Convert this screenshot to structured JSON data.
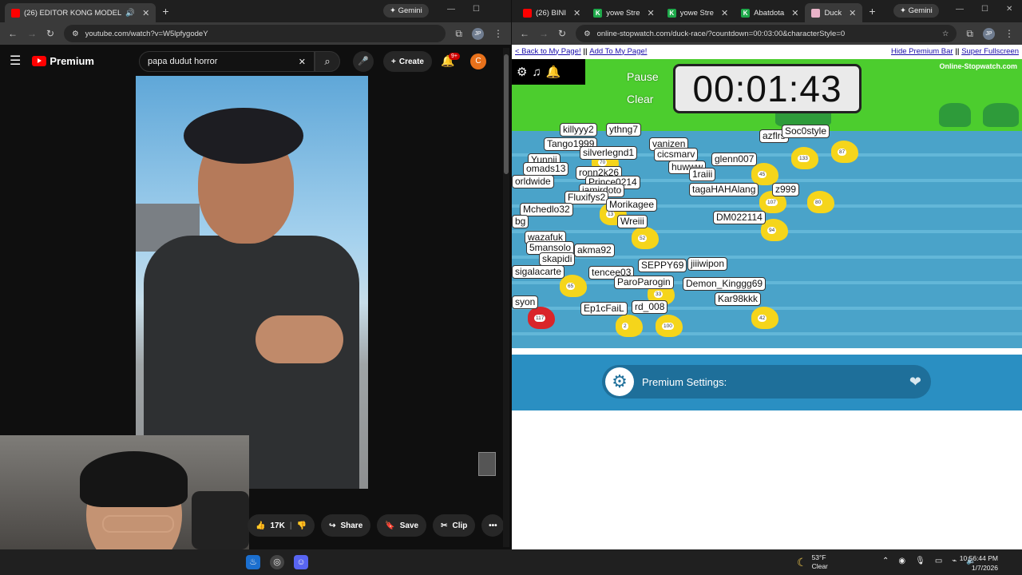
{
  "left_browser": {
    "tab_title": "(26) EDITOR KONG MODEL",
    "gemini_label": "Gemini",
    "url": "youtube.com/watch?v=W5lpfygodeY",
    "profile_initials": "JP"
  },
  "youtube": {
    "logo_text": "Premium",
    "search_value": "papa dudut horror",
    "create_label": "Create",
    "notifications_badge": "9+",
    "user_initial": "C",
    "actions": {
      "likes": "17K",
      "share": "Share",
      "save": "Save",
      "clip": "Clip"
    }
  },
  "right_browser": {
    "tabs": [
      {
        "label": "(26) BINI",
        "icon": "youtube-icon"
      },
      {
        "label": "yowe Stre",
        "icon": "kick-icon"
      },
      {
        "label": "yowe Stre",
        "icon": "kick-icon"
      },
      {
        "label": "Abatdota",
        "icon": "kick-icon"
      },
      {
        "label": "Duck",
        "icon": "duck-icon"
      }
    ],
    "gemini_label": "Gemini",
    "url": "online-stopwatch.com/duck-race/?countdown=00:03:00&characterStyle=0",
    "profile_initials": "JP"
  },
  "page": {
    "back_link": "< Back to My Page!",
    "add_link": "Add To My Page!",
    "hide_link": "Hide Premium Bar",
    "fullscreen_link": "Super Fullscreen",
    "pause_label": "Pause",
    "clear_label": "Clear",
    "timer": "00:01:43",
    "brand": "Online-Stopwatch.com",
    "premium_settings": "Premium Settings:"
  },
  "race": {
    "racers": [
      {
        "name": "killyyy2",
        "color": "#f5d51b"
      },
      {
        "name": "ythng7",
        "color": "#f5d51b"
      },
      {
        "name": "Tango1999",
        "color": "#f5d51b"
      },
      {
        "name": "silverlegnd1",
        "color": "#f5d51b"
      },
      {
        "name": "vanizen",
        "color": "#f5d51b"
      },
      {
        "name": "azflrs",
        "color": "#f5d51b"
      },
      {
        "name": "Soc0style",
        "color": "#f5d51b"
      },
      {
        "name": "Yunnii",
        "color": "#f5d51b"
      },
      {
        "name": "cicsmarv",
        "color": "#f5d51b"
      },
      {
        "name": "omads13",
        "color": "#f5d51b"
      },
      {
        "name": "huwww",
        "color": "#f5d51b"
      },
      {
        "name": "glenn007",
        "color": "#d9252a"
      },
      {
        "name": "ronn2k26",
        "color": "#f5d51b"
      },
      {
        "name": "1raiii",
        "color": "#f5d51b"
      },
      {
        "name": "orldwide",
        "color": "#f5d51b"
      },
      {
        "name": "Prince0214",
        "color": "#f5d51b"
      },
      {
        "name": "iamirdoto",
        "color": "#f5d51b"
      },
      {
        "name": "tagaHAHAlang",
        "color": "#f5d51b"
      },
      {
        "name": "z999",
        "color": "#d9252a"
      },
      {
        "name": "Fluxifys2",
        "color": "#f5d51b"
      },
      {
        "name": "Morikagee",
        "color": "#f5d51b"
      },
      {
        "name": "Mchedlo32",
        "color": "#f5d51b"
      },
      {
        "name": "DM022114",
        "color": "#8a3fd1"
      },
      {
        "name": "Wreiii",
        "color": "#f5d51b"
      },
      {
        "name": "bg",
        "color": "#f5d51b"
      },
      {
        "name": "wazafuk",
        "color": "#f5d51b"
      },
      {
        "name": "5mansolo",
        "color": "#f5d51b"
      },
      {
        "name": "akma92",
        "color": "#f5d51b"
      },
      {
        "name": "skapidi",
        "color": "#f5d51b"
      },
      {
        "name": "SEPPY69",
        "color": "#f5d51b"
      },
      {
        "name": "jiiiwipon",
        "color": "#f5d51b"
      },
      {
        "name": "sigalacarte",
        "color": "#f5d51b"
      },
      {
        "name": "tencee03",
        "color": "#f5d51b"
      },
      {
        "name": "ParoParogin",
        "color": "#f5d51b"
      },
      {
        "name": "Demon_Kinggg69",
        "color": "#f5d51b"
      },
      {
        "name": "Kar98kkk",
        "color": "#f5d51b"
      },
      {
        "name": "syon",
        "color": "#d9252a"
      },
      {
        "name": "Ep1cFaiL",
        "color": "#f5d51b"
      },
      {
        "name": "rd_008",
        "color": "#f5d51b"
      }
    ],
    "duck_numbers": [
      "133",
      "87",
      "45",
      "107",
      "80",
      "94",
      "52",
      "13",
      "65",
      "33",
      "42",
      "117",
      "2",
      "100",
      "70"
    ]
  },
  "taskbar": {
    "temperature": "53°F",
    "condition": "Clear",
    "time": "10:56:44 PM",
    "date": "1/7/2026"
  }
}
